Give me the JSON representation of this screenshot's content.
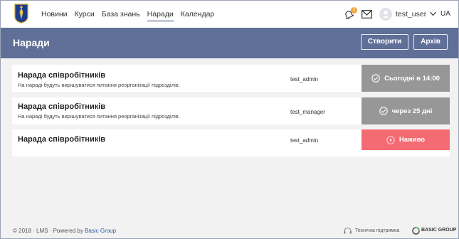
{
  "nav": {
    "items": [
      {
        "label": "Новини",
        "active": false
      },
      {
        "label": "Курси",
        "active": false
      },
      {
        "label": "База знань",
        "active": false
      },
      {
        "label": "Наради",
        "active": true
      },
      {
        "label": "Календар",
        "active": false
      }
    ]
  },
  "user": {
    "notification_count": "2",
    "username": "test_user",
    "language": "UA"
  },
  "header": {
    "title": "Наради",
    "create_label": "Створити",
    "archive_label": "Архів"
  },
  "meetings": [
    {
      "title": "Нарада співробітників",
      "description": "На нараді будуть вирішуватися питання реорганізації підрозділів.",
      "owner": "test_admin",
      "status": "Сьогодні в 14:00",
      "status_icon": "check-circle-icon",
      "status_color": "#979797"
    },
    {
      "title": "Нарада співробітників",
      "description": "На нараді будуть вирішуватися питання реорганізації підрозділів.",
      "owner": "test_manager",
      "status": "через 25 дні",
      "status_icon": "check-circle-icon",
      "status_color": "#979797"
    },
    {
      "title": "Нарада співробітників",
      "description": "",
      "owner": "test_admin",
      "status": "Наживо",
      "status_icon": "play-circle-icon",
      "status_color": "#f46b73"
    }
  ],
  "footer": {
    "copyright": "© 2018 · LMS · Powered by ",
    "powered_link": "Basic Group",
    "support": "Технічна підтримка",
    "brand": "BASIC GROUP"
  },
  "colors": {
    "band": "#5f6f98",
    "active_underline": "#2a3b6e",
    "badge": "#f2a33a"
  }
}
